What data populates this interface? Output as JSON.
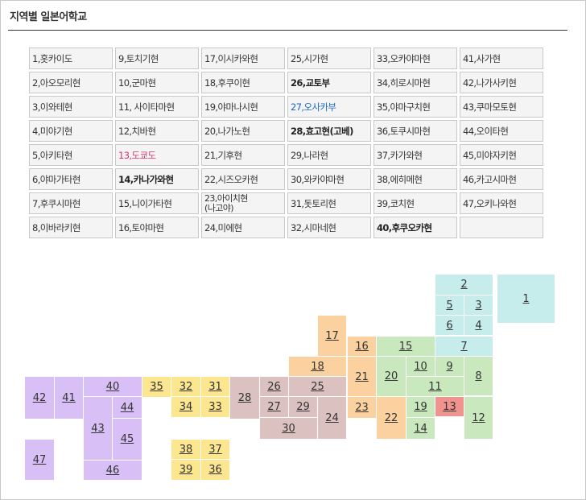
{
  "page": {
    "title": "지역별 일본어학교"
  },
  "table": {
    "rows": [
      [
        "1,홋카이도",
        "9,토치기현",
        "17,이시카와현",
        "25,시가현",
        "33,오카야마현",
        "41,사가현"
      ],
      [
        "2,아오모리현",
        "10,군마현",
        "18,후쿠이현",
        "26,교토부",
        "34,히로시마현",
        "42,나가사키현"
      ],
      [
        "3,이와테현",
        "11, 사이타마현",
        "19,야마나시현",
        "27,오사카부",
        "35,야마구치현",
        "43,쿠마모토현"
      ],
      [
        "4,미야기현",
        "12,치바현",
        "20,나가노현",
        "28,효고현(고베)",
        "36,토쿠시마현",
        "44,오이타현"
      ],
      [
        "5,아키타현",
        "13,도쿄도",
        "21,기후현",
        "29,나라현",
        "37,카가와현",
        "45,미야자키현"
      ],
      [
        "6,야마가타현",
        "14,카나가와현",
        "22,시즈오카현",
        "30,와카야마현",
        "38,에히메현",
        "46,카고시마현"
      ],
      [
        "7,후쿠시마현",
        "15,니이가타현",
        "23,아이치현\n(나고야)",
        "31,돗토리현",
        "39,코치현",
        "47,오키나와현"
      ],
      [
        "8,이바라키현",
        "16,토야마현",
        "24,미에현",
        "32,시마네현",
        "40,후쿠오카현",
        ""
      ]
    ]
  },
  "map": {
    "region_colors": {
      "hokkaido": "#c6ecec",
      "tohoku": "#c6ecec",
      "kanto": "#c9e8bd",
      "tokyo": "#f0938f",
      "chubu": "#fbd19f",
      "kinki": "#dcc1c1",
      "chugoku": "#fce690",
      "shikoku": "#fce690",
      "kyushu": "#d8bff5"
    },
    "cells": [
      {
        "id": "1",
        "region": "hok"
      },
      {
        "id": "2",
        "region": "toh"
      },
      {
        "id": "3",
        "region": "toh"
      },
      {
        "id": "4",
        "region": "toh"
      },
      {
        "id": "5",
        "region": "toh"
      },
      {
        "id": "6",
        "region": "toh"
      },
      {
        "id": "7",
        "region": "toh"
      },
      {
        "id": "8",
        "region": "kan"
      },
      {
        "id": "9",
        "region": "kan"
      },
      {
        "id": "10",
        "region": "kan"
      },
      {
        "id": "11",
        "region": "kan"
      },
      {
        "id": "12",
        "region": "kan"
      },
      {
        "id": "13",
        "region": "tok"
      },
      {
        "id": "14",
        "region": "kan"
      },
      {
        "id": "15",
        "region": "kan"
      },
      {
        "id": "16",
        "region": "chu"
      },
      {
        "id": "17",
        "region": "chu"
      },
      {
        "id": "18",
        "region": "chu"
      },
      {
        "id": "19",
        "region": "kan"
      },
      {
        "id": "20",
        "region": "kan"
      },
      {
        "id": "21",
        "region": "chu"
      },
      {
        "id": "22",
        "region": "chu"
      },
      {
        "id": "23",
        "region": "chu"
      },
      {
        "id": "24",
        "region": "kin"
      },
      {
        "id": "25",
        "region": "kin"
      },
      {
        "id": "26",
        "region": "kin"
      },
      {
        "id": "27",
        "region": "kin"
      },
      {
        "id": "28",
        "region": "kin"
      },
      {
        "id": "29",
        "region": "kin"
      },
      {
        "id": "30",
        "region": "kin"
      },
      {
        "id": "31",
        "region": "chg"
      },
      {
        "id": "32",
        "region": "chg"
      },
      {
        "id": "33",
        "region": "chg"
      },
      {
        "id": "34",
        "region": "chg"
      },
      {
        "id": "35",
        "region": "chg"
      },
      {
        "id": "36",
        "region": "shi"
      },
      {
        "id": "37",
        "region": "shi"
      },
      {
        "id": "38",
        "region": "shi"
      },
      {
        "id": "39",
        "region": "shi"
      },
      {
        "id": "40",
        "region": "kyu"
      },
      {
        "id": "41",
        "region": "kyu"
      },
      {
        "id": "42",
        "region": "kyu"
      },
      {
        "id": "43",
        "region": "kyu"
      },
      {
        "id": "44",
        "region": "kyu"
      },
      {
        "id": "45",
        "region": "kyu"
      },
      {
        "id": "46",
        "region": "kyu"
      },
      {
        "id": "47",
        "region": "kyu"
      }
    ]
  }
}
